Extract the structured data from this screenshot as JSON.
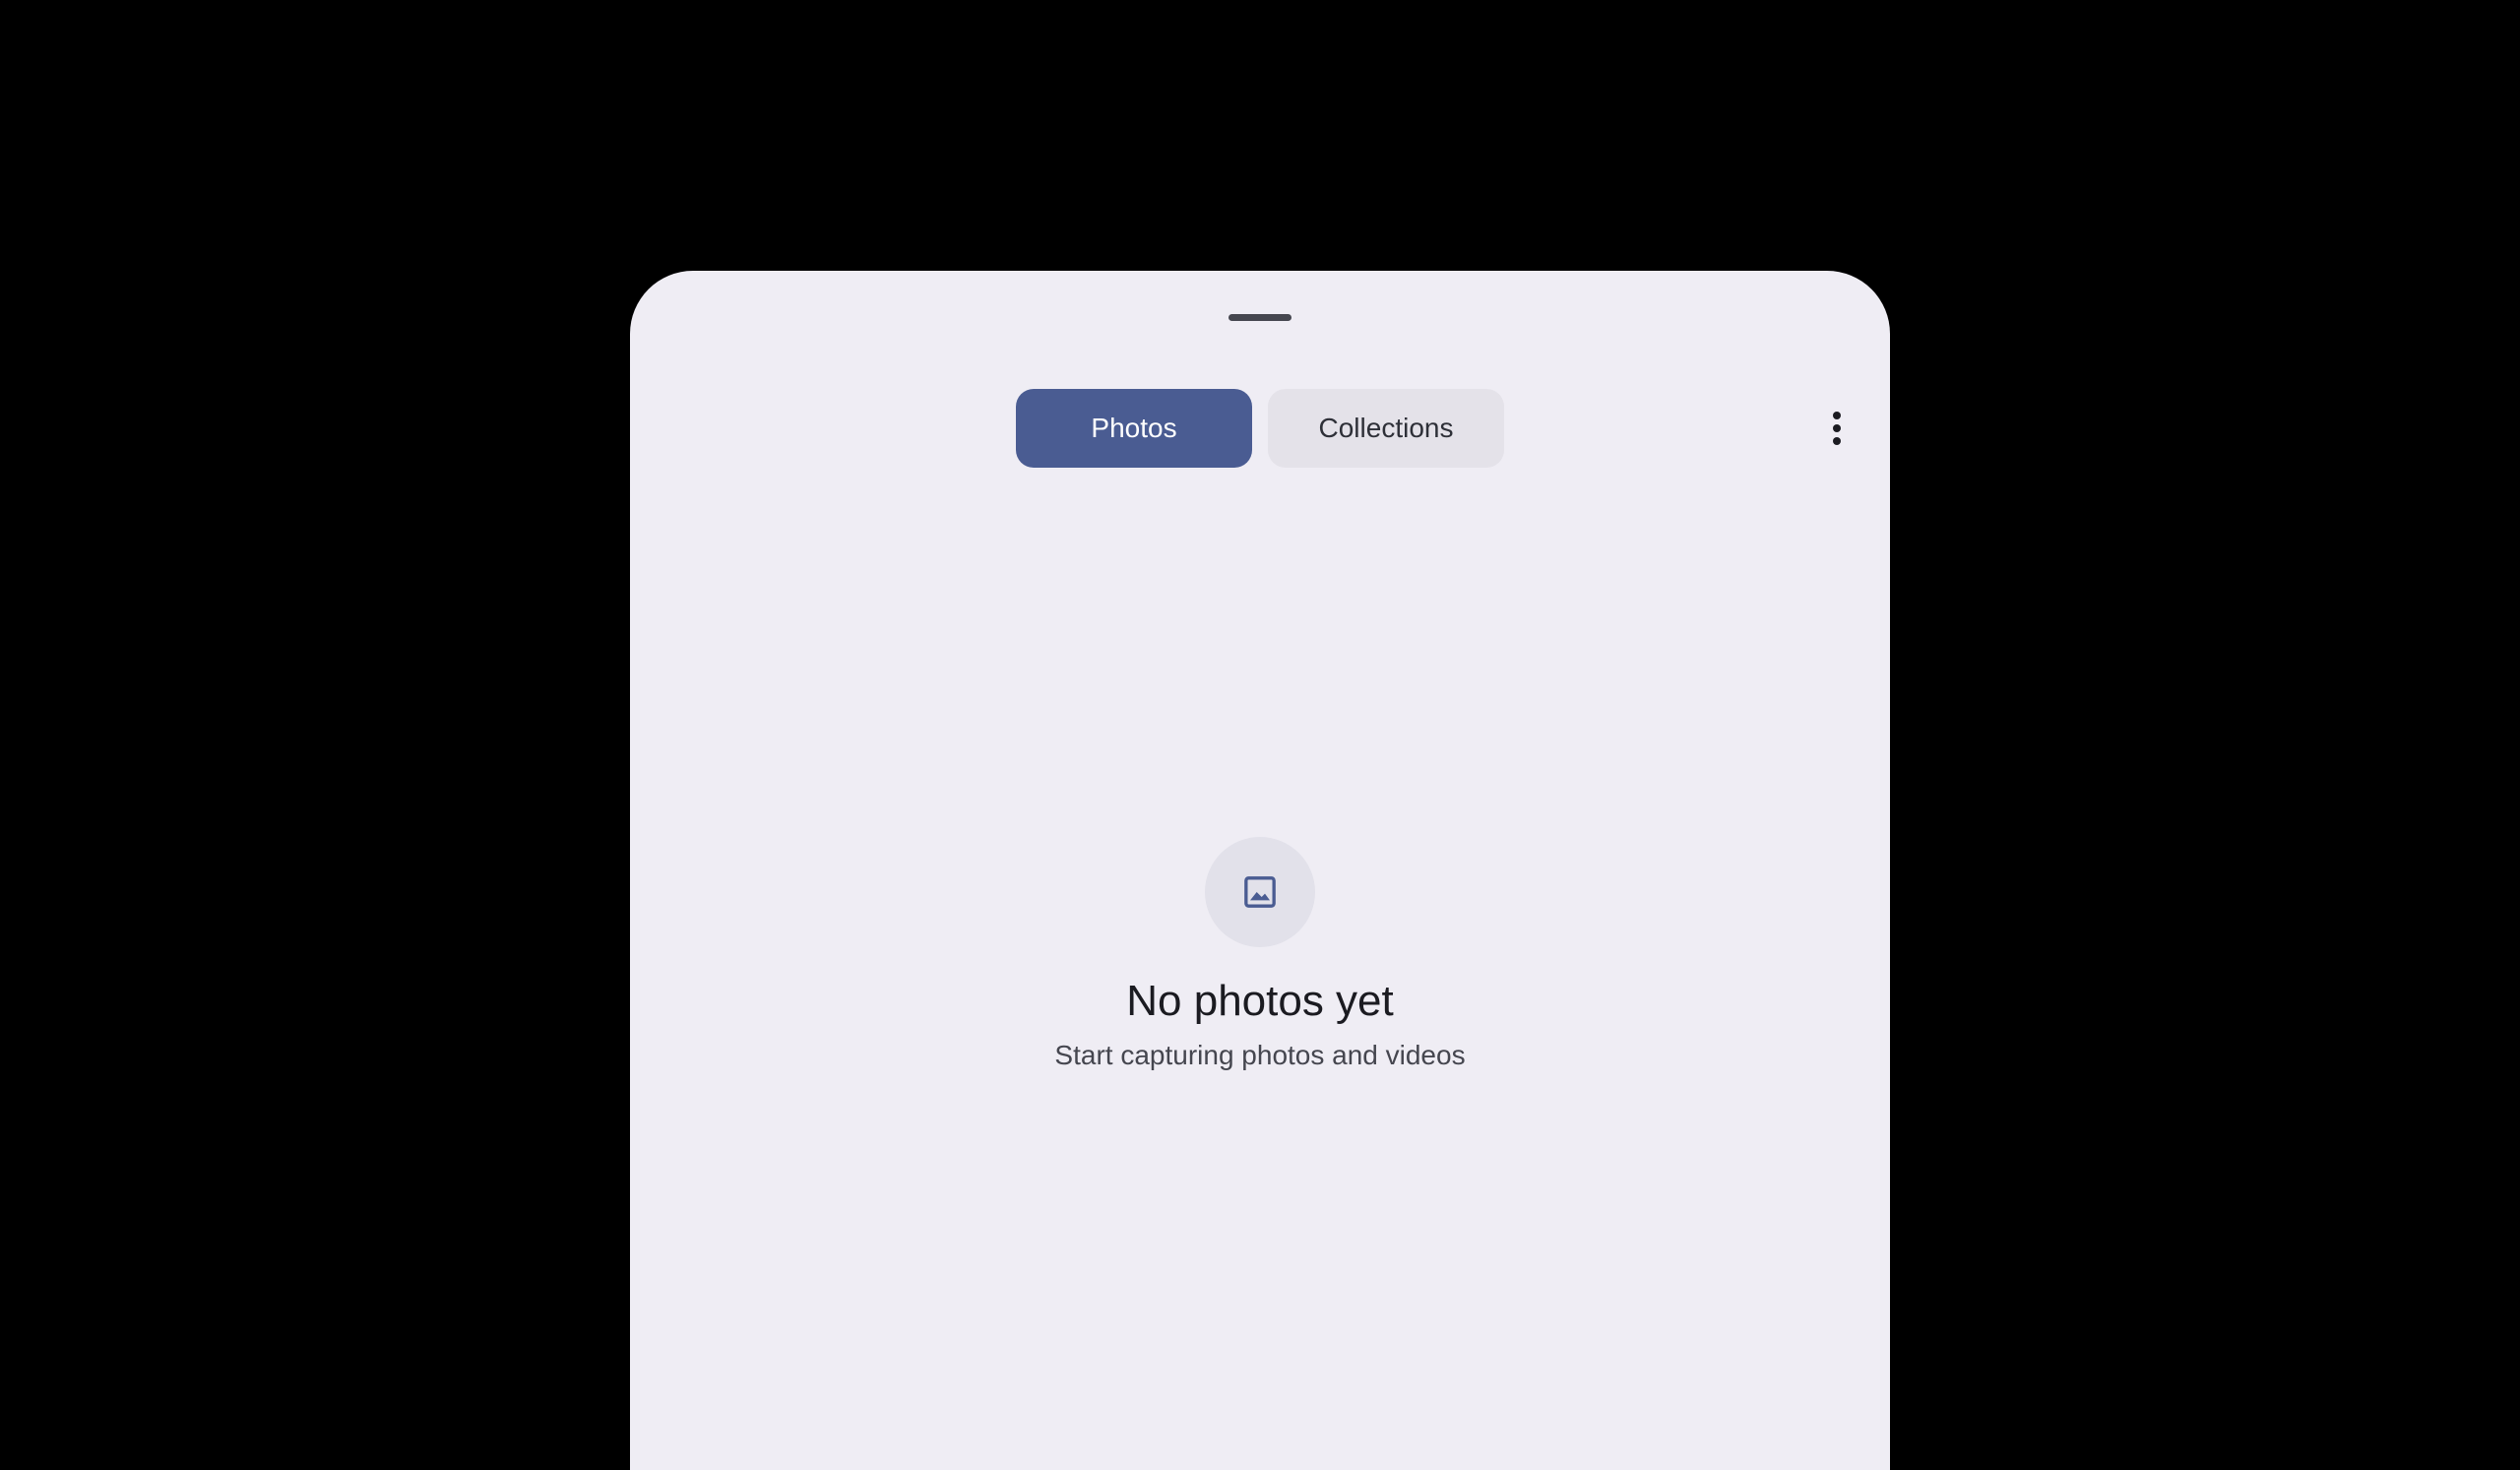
{
  "tabs": [
    {
      "label": "Photos",
      "active": true
    },
    {
      "label": "Collections",
      "active": false
    }
  ],
  "menu": {
    "icon": "more-vert-icon"
  },
  "empty_state": {
    "icon": "image-icon",
    "title": "No photos yet",
    "subtitle": "Start capturing photos and videos"
  },
  "colors": {
    "background": "#000000",
    "sheet": "#efedf4",
    "accent": "#4a5c92",
    "inactive_tab": "#e4e2e9",
    "icon_circle": "#e2e1ea"
  }
}
